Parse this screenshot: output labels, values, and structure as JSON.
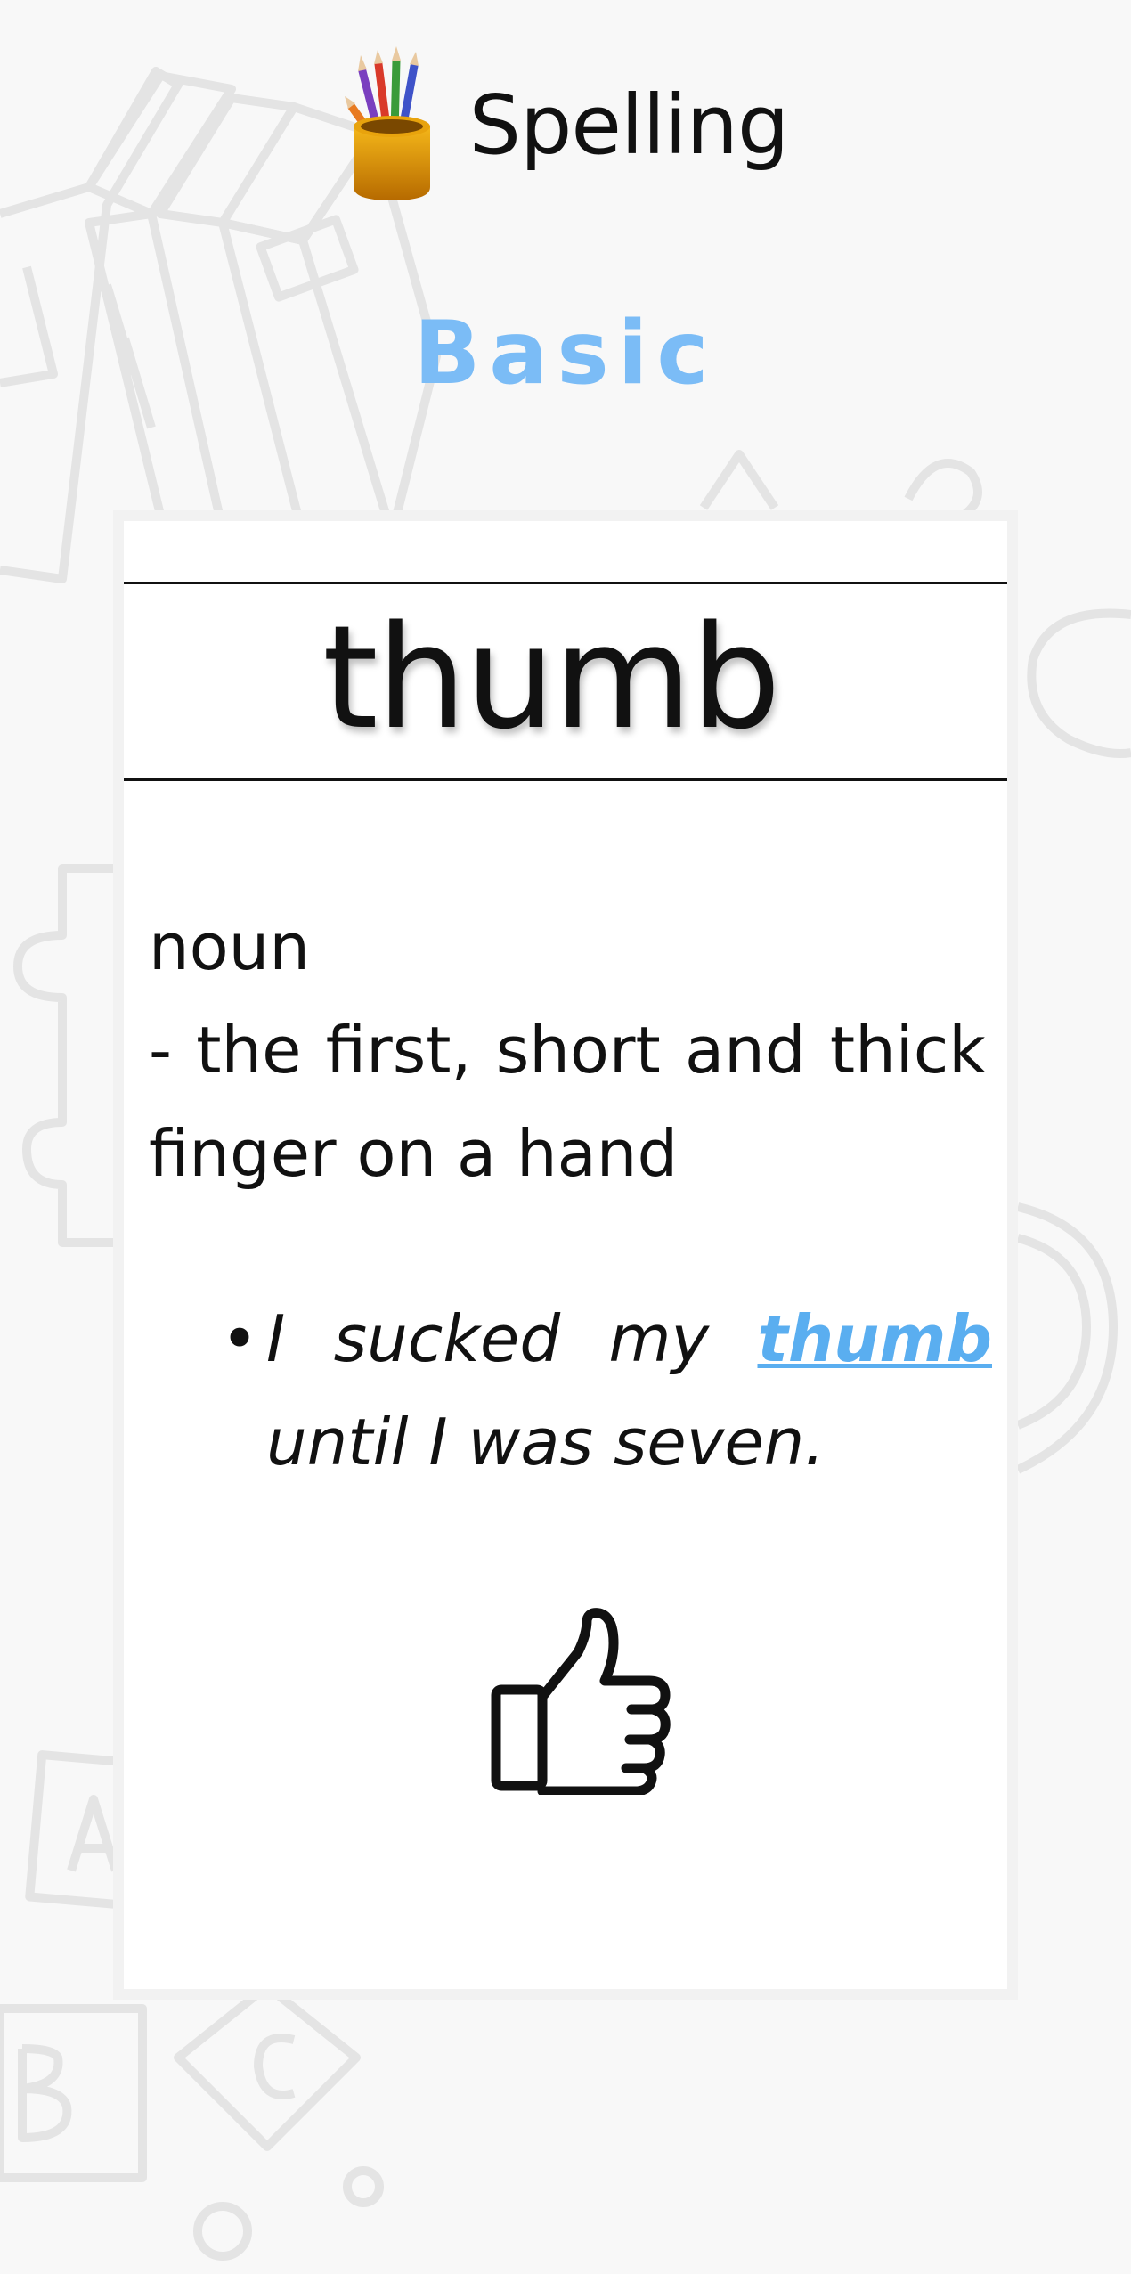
{
  "app": {
    "title": "Spelling",
    "icon": "pencil-cup-icon"
  },
  "level": {
    "label": "Basic",
    "color": "#7bbcf6"
  },
  "card": {
    "word": "thumb",
    "part_of_speech": "noun",
    "definition": " - the first, short and thick finger on a hand",
    "example": {
      "bullet": "•",
      "before": "I sucked my ",
      "highlight": "thumb",
      "after": " until I was seven."
    },
    "illustration": "thumbs-up-icon"
  },
  "colors": {
    "background": "#f8f8f8",
    "card": "#ffffff",
    "highlight": "#5aaef0"
  }
}
